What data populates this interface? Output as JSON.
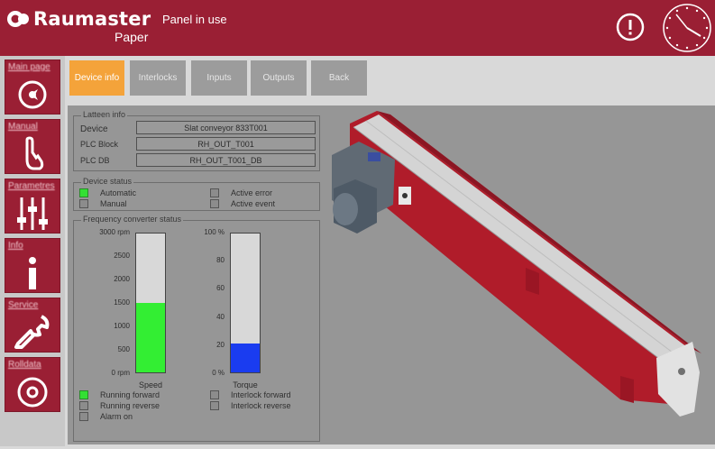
{
  "header": {
    "brand": "Raumaster",
    "brand_sub": "Paper",
    "status": "Panel in use",
    "alert_icon": "exclamation-circle-icon",
    "clock_icon": "clock-icon"
  },
  "sidebar": {
    "items": [
      {
        "label": "Main page",
        "icon": "cursor-disc-icon"
      },
      {
        "label": "Manual",
        "icon": "hand-icon"
      },
      {
        "label": "Parametres",
        "icon": "sliders-icon"
      },
      {
        "label": "Info",
        "icon": "info-icon"
      },
      {
        "label": "Service",
        "icon": "wrench-icon"
      },
      {
        "label": "Rolldata",
        "icon": "roll-icon"
      }
    ]
  },
  "tabs": [
    {
      "label": "Device info",
      "active": true
    },
    {
      "label": "Interlocks",
      "active": false
    },
    {
      "label": "Inputs",
      "active": false
    },
    {
      "label": "Outputs",
      "active": false
    },
    {
      "label": "Back",
      "active": false
    }
  ],
  "device_info": {
    "legend": "Latteen info",
    "rows": [
      {
        "label": "Device",
        "value": "Slat conveyor 833T001"
      },
      {
        "label": "PLC Block",
        "value": "RH_OUT_T001"
      },
      {
        "label": "PLC DB",
        "value": "RH_OUT_T001_DB"
      }
    ]
  },
  "device_status": {
    "legend": "Device status",
    "left": [
      {
        "label": "Automatic",
        "on": true
      },
      {
        "label": "Manual",
        "on": false
      }
    ],
    "right": [
      {
        "label": "Active error",
        "on": false
      },
      {
        "label": "Active event",
        "on": false
      }
    ]
  },
  "freq": {
    "legend": "Frequency converter status",
    "speed": {
      "caption": "Speed",
      "ticks": [
        "3000 rpm",
        "2500",
        "2000",
        "1500",
        "1000",
        "500",
        "0 rpm"
      ],
      "max": 3000,
      "value": 1500,
      "color": "#33ee33"
    },
    "torque": {
      "caption": "Torque",
      "ticks": [
        "100 %",
        "80",
        "60",
        "40",
        "20",
        "0 %"
      ],
      "max": 100,
      "value": 21,
      "color": "#1a3cf0"
    },
    "left_status": [
      {
        "label": "Running forward",
        "on": true
      },
      {
        "label": "Running reverse",
        "on": false
      },
      {
        "label": "Alarm on",
        "on": false
      }
    ],
    "right_status": [
      {
        "label": "Interlock forward",
        "on": false
      },
      {
        "label": "Interlock reverse",
        "on": false
      }
    ]
  },
  "colors": {
    "brand": "#9a1f34",
    "tab_active": "#f4a33a",
    "tab_inactive": "#9c9c9c",
    "panel": "#969696"
  }
}
